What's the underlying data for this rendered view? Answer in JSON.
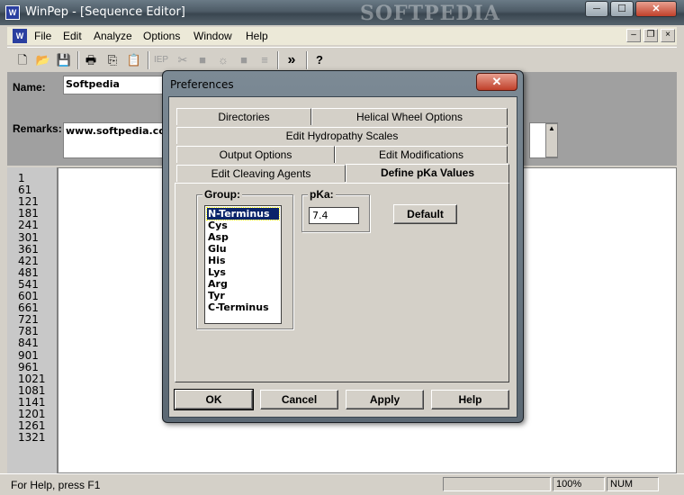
{
  "window": {
    "title": "WinPep - [Sequence Editor]",
    "app_icon": "winpep-app-icon",
    "watermark": "SOFTPEDIA",
    "min_glyph": "─",
    "max_glyph": "☐",
    "close_glyph": "✕"
  },
  "menu": {
    "items": [
      "File",
      "Edit",
      "Analyze",
      "Options",
      "Window",
      "Help"
    ],
    "mdi_controls": [
      "–",
      "❐",
      "×"
    ]
  },
  "toolbar": {
    "buttons": [
      {
        "icon": "new-file-icon",
        "glyph": "🗋",
        "enabled": true
      },
      {
        "icon": "open-folder-icon",
        "glyph": "📂",
        "enabled": true
      },
      {
        "icon": "save-icon",
        "glyph": "💾",
        "enabled": true
      },
      {
        "icon": "print-icon",
        "glyph": "🖶",
        "enabled": true
      },
      {
        "icon": "copy-icon",
        "glyph": "⎘",
        "enabled": true
      },
      {
        "icon": "paste-icon",
        "glyph": "📋",
        "enabled": true
      },
      {
        "icon": "iep-icon",
        "glyph": "IEP",
        "enabled": false
      },
      {
        "icon": "cleave-icon",
        "glyph": "✂",
        "enabled": false
      },
      {
        "icon": "block-icon",
        "glyph": "■",
        "enabled": false
      },
      {
        "icon": "sun-icon",
        "glyph": "☼",
        "enabled": false
      },
      {
        "icon": "block2-icon",
        "glyph": "■",
        "enabled": false
      },
      {
        "icon": "lines-icon",
        "glyph": "≡",
        "enabled": false
      },
      {
        "icon": "forward-icon",
        "glyph": "»",
        "enabled": true
      },
      {
        "icon": "help-icon",
        "glyph": "?",
        "enabled": true
      }
    ]
  },
  "editor": {
    "name_label": "Name:",
    "name_value": "Softpedia",
    "remarks_label": "Remarks:",
    "remarks_value": "www.softpedia.com",
    "line_numbers": [
      "1",
      "61",
      "121",
      "181",
      "241",
      "301",
      "361",
      "421",
      "481",
      "541",
      "601",
      "661",
      "721",
      "781",
      "841",
      "901",
      "961",
      "1021",
      "1081",
      "1141",
      "1201",
      "1261",
      "1321"
    ]
  },
  "status": {
    "text": "For Help, press F1",
    "zoom": "100%",
    "num": "NUM"
  },
  "dialog": {
    "title": "Preferences",
    "close_glyph": "✕",
    "tabs": [
      "Directories",
      "Helical Wheel Options",
      "Edit Hydropathy Scales",
      "Output Options",
      "Edit Modifications",
      "Edit Cleaving Agents",
      "Define pKa Values"
    ],
    "active_tab": "Define pKa Values",
    "group_label": "Group:",
    "groups": [
      "N-Terminus",
      "Cys",
      "Asp",
      "Glu",
      "His",
      "Lys",
      "Arg",
      "Tyr",
      "C-Terminus"
    ],
    "selected_group": "N-Terminus",
    "pka_label": "pKa:",
    "pka_value": "7.4",
    "default_button": "Default",
    "ok_button": "OK",
    "cancel_button": "Cancel",
    "apply_button": "Apply",
    "help_button": "Help"
  }
}
